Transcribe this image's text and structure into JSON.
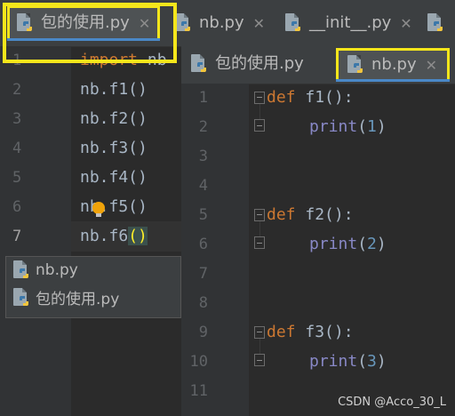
{
  "top_tabs": [
    {
      "label": "包的使用.py",
      "active": true
    },
    {
      "label": "nb.py",
      "active": false
    },
    {
      "label": "__init__.py",
      "active": false
    }
  ],
  "left_editor": {
    "line_numbers": [
      "1",
      "2",
      "3",
      "4",
      "5",
      "6",
      "7"
    ],
    "lines": [
      {
        "kw": "import",
        "rest": " nb"
      },
      {
        "text": "nb.f1()"
      },
      {
        "text": "nb.f2()"
      },
      {
        "text": "nb.f3()"
      },
      {
        "text": "nb.f4()"
      },
      {
        "text": "nb.f5()"
      },
      {
        "before": "nb.f6",
        "paren": "()"
      }
    ]
  },
  "autocomplete": {
    "items": [
      "nb.py",
      "包的使用.py"
    ]
  },
  "right_tabs": [
    {
      "label": "包的使用.py",
      "active": false
    },
    {
      "label": "nb.py",
      "active": true
    }
  ],
  "right_editor": {
    "line_numbers": [
      "1",
      "2",
      "3",
      "4",
      "5",
      "6",
      "7",
      "8",
      "9",
      "10",
      "11"
    ],
    "defs": [
      {
        "kw": "def",
        "name": " f1():",
        "call": "print",
        "arg": "1"
      },
      {
        "kw": "def",
        "name": " f2():",
        "call": "print",
        "arg": "2"
      },
      {
        "kw": "def",
        "name": " f3():",
        "call": "print",
        "arg": "3"
      }
    ]
  },
  "watermark": "CSDN @Acco_30_L",
  "colors": {
    "highlight": "#f5e61b",
    "keyword": "#cc7832",
    "number": "#6897bb",
    "builtin": "#8888c6"
  }
}
